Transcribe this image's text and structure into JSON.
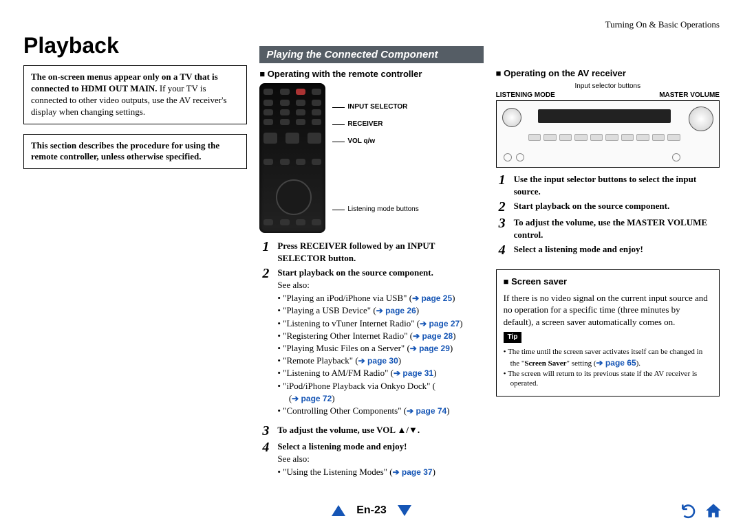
{
  "header": {
    "breadcrumb": "Turning On & Basic Operations"
  },
  "title": "Playback",
  "col1": {
    "note_html": "The on-screen menus appear only on a TV that is connected to HDMI OUT MAIN. If your TV is connected to other video outputs, use the AV receiver's display when changing settings.",
    "intro": "This section describes the procedure for using the remote controller, unless otherwise specified."
  },
  "col2": {
    "section_title": "Playing the Connected Component",
    "sub1": "Operating with the remote controller",
    "remote_labels": {
      "l1": "INPUT SELECTOR",
      "l2": "RECEIVER",
      "l3": "VOL q/w"
    },
    "listening_note": "Listening mode buttons",
    "steps": [
      {
        "num": "1",
        "bold": "Press RECEIVER followed by an INPUT SELECTOR button."
      },
      {
        "num": "2",
        "bold": "Start playback on the source component.",
        "extra": "See also:",
        "bullets": [
          {
            "t": "\"Playing an iPod/iPhone via USB\" (",
            "xref": "➔ page 25",
            "after": ")"
          },
          {
            "t": "\"Playing a USB Device\" (",
            "xref": "➔ page 26",
            "after": ")"
          },
          {
            "t": "\"Listening to vTuner Internet Radio\" (",
            "xref": "➔ page 27",
            "after": ")"
          },
          {
            "t": "\"Registering Other Internet Radio\" (",
            "xref": "➔ page 28",
            "after": ")"
          },
          {
            "t": "\"Playing Music Files on a Server\" (",
            "xref": "➔ page 29",
            "after": ")"
          },
          {
            "t": "\"Remote Playback\" (",
            "xref": "➔ page 30",
            "after": ")"
          },
          {
            "t": "\"Listening to AM/FM Radio\" (",
            "xref": "➔ page 31",
            "after": ")"
          },
          {
            "t": "\"iPod/iPhone Playback via Onkyo Dock\" (",
            "xref": "➔ page 72",
            "after": ")"
          },
          {
            "t": "\"Controlling Other Components\" (",
            "xref": "➔ page 74",
            "after": ")"
          }
        ]
      },
      {
        "num": "3",
        "bold": "To adjust the volume, use VOL ▲/▼."
      },
      {
        "num": "4",
        "bold": "Select a listening mode and enjoy!",
        "extra": "See also:",
        "bullets": [
          {
            "t": "\"Using the Listening Modes\" (",
            "xref": "➔ page 37",
            "after": ")"
          }
        ]
      }
    ]
  },
  "col3": {
    "sub1": "Operating on the AV receiver",
    "cap_top": "Input selector buttons",
    "cap_left": "LISTENING MODE",
    "cap_right": "MASTER VOLUME",
    "steps": [
      {
        "num": "1",
        "bold": "Use the input selector buttons to select the input source."
      },
      {
        "num": "2",
        "bold": "Start playback on the source component."
      },
      {
        "num": "3",
        "bold": "To adjust the volume, use the MASTER VOLUME control."
      },
      {
        "num": "4",
        "bold": "Select a listening mode and enjoy!"
      }
    ],
    "screen": {
      "title": "Screen saver",
      "body": "If there is no video signal on the current input source and no operation for a specific time (three minutes by default), a screen saver automatically comes on.",
      "tip_label": "Tip",
      "tips": [
        {
          "pre": "The time until the screen saver activates itself can be changed in the \"",
          "bold": "Screen Saver",
          "mid": "\" setting (",
          "xref": "➔ page 65",
          "after": ")."
        },
        {
          "pre": "The screen will return to its previous state if the AV receiver is operated."
        }
      ]
    }
  },
  "footer": {
    "page": "En-23"
  }
}
